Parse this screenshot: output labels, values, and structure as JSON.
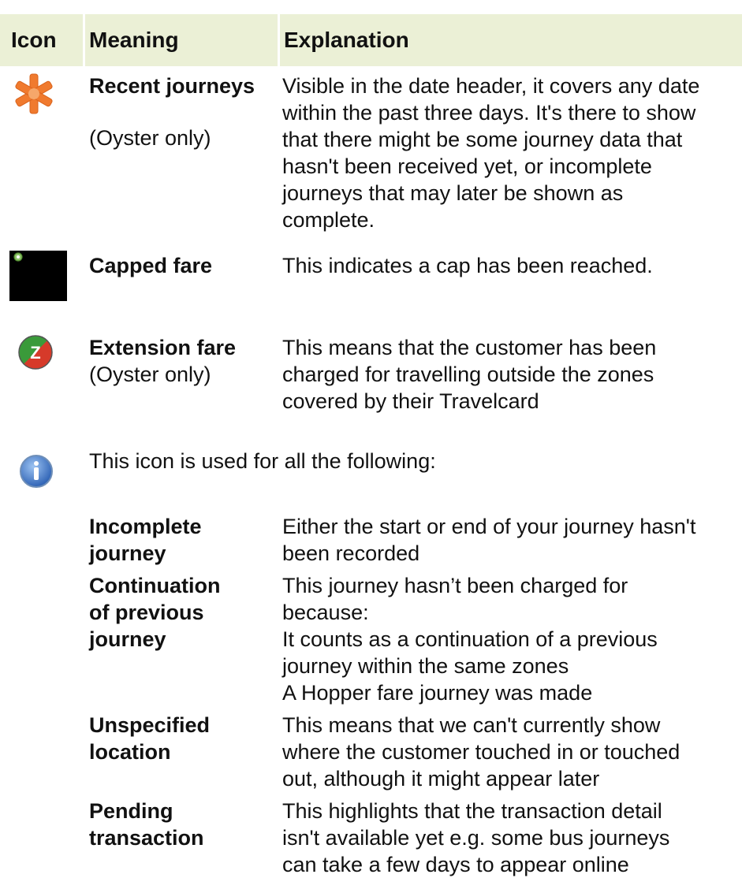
{
  "header": {
    "icon": "Icon",
    "meaning": "Meaning",
    "explanation": "Explanation"
  },
  "rows": {
    "recent": {
      "icon": "asterisk-icon",
      "meaning": "Recent journeys",
      "note": "(Oyster only)",
      "explanation": [
        "Visible in the date header, it covers any date",
        "within the past three days. It's there to show",
        "that there might be some journey data that",
        "hasn't been received yet, or incomplete",
        "journeys that may later be shown as",
        "complete."
      ]
    },
    "capped": {
      "icon": "capped-fare-icon",
      "meaning": "Capped fare",
      "explanation": "This indicates a cap has been reached."
    },
    "extension": {
      "icon": "extension-z-icon",
      "meaning": "Extension fare",
      "note": "(Oyster only)",
      "explanation": [
        "This means that the customer has been",
        "charged for travelling outside the zones",
        "covered by their Travelcard"
      ]
    },
    "info": {
      "icon": "info-icon",
      "intro": "This icon is used for all the following:"
    }
  },
  "subrows": {
    "incomplete": {
      "meaning": [
        "Incomplete",
        "journey"
      ],
      "explanation": [
        "Either the start or end of your journey hasn't",
        "been recorded"
      ]
    },
    "continuation": {
      "meaning": [
        "Continuation",
        "of previous",
        "journey"
      ],
      "explanation": [
        "This journey hasn’t been charged for",
        "because:",
        "It counts as a continuation of a previous",
        "journey within the same zones",
        "A Hopper fare journey was made"
      ]
    },
    "unspecified": {
      "meaning": [
        "Unspecified",
        "location"
      ],
      "explanation": [
        "This means that we can't currently show",
        "where the customer touched in or touched",
        "out, although it might appear later"
      ]
    },
    "pending": {
      "meaning": [
        "Pending",
        "transaction"
      ],
      "explanation": [
        "This highlights that the transaction detail",
        "isn't available yet e.g. some bus journeys",
        "can take a few days to appear online"
      ]
    }
  },
  "colors": {
    "header_bg": "#ebf0d6",
    "asterisk": "#f07a2e",
    "capped_block": "#000000",
    "z_green": "#3a9a3a",
    "z_red": "#d63a2a",
    "info_blue": "#3f78c9"
  }
}
